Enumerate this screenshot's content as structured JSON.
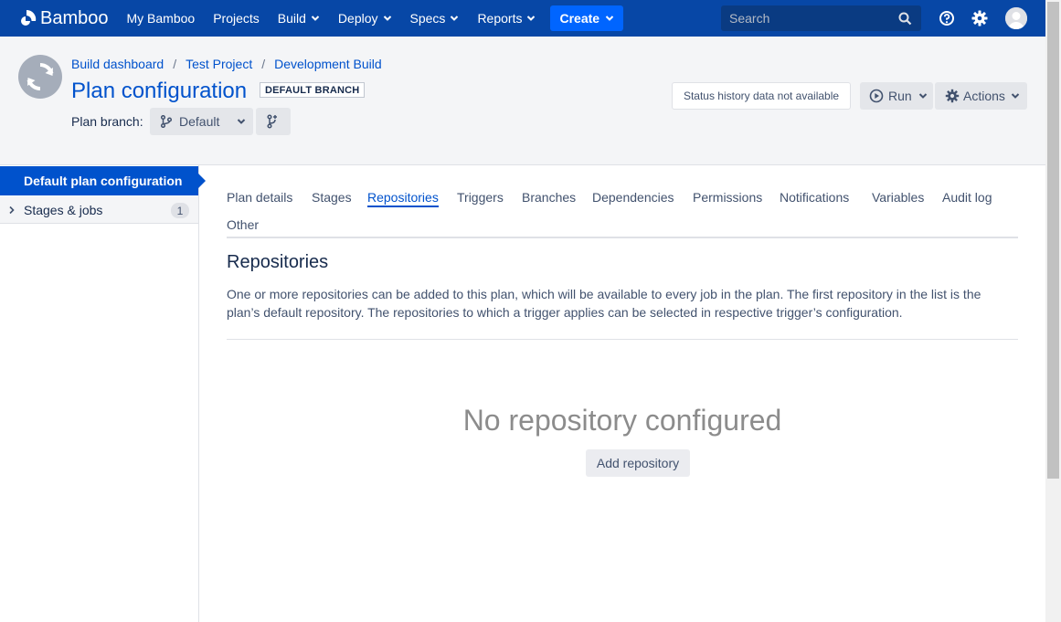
{
  "topnav": {
    "logo_text": "Bamboo",
    "items": [
      {
        "label": "My Bamboo",
        "has_dropdown": false
      },
      {
        "label": "Projects",
        "has_dropdown": false
      },
      {
        "label": "Build",
        "has_dropdown": true
      },
      {
        "label": "Deploy",
        "has_dropdown": true
      },
      {
        "label": "Specs",
        "has_dropdown": true
      },
      {
        "label": "Reports",
        "has_dropdown": true
      }
    ],
    "create_label": "Create",
    "search_placeholder": "Search",
    "bg_color": "#0747a6",
    "create_color": "#0065ff"
  },
  "header": {
    "breadcrumb": [
      "Build dashboard",
      "Test Project",
      "Development Build"
    ],
    "title": "Plan configuration",
    "badge": "DEFAULT BRANCH",
    "plan_branch_label": "Plan branch:",
    "branch_value": "Default",
    "status_text": "Status history data not available",
    "run_label": "Run",
    "actions_label": "Actions"
  },
  "sidebar": {
    "active_label": "Default plan configuration",
    "items": [
      {
        "label": "Stages & jobs",
        "count": "1"
      }
    ]
  },
  "tabs": [
    "Plan details",
    "Stages",
    "Repositories",
    "Triggers",
    "Branches",
    "Dependencies",
    "Permissions",
    "Notifications",
    "Variables",
    "Audit log",
    "Other"
  ],
  "active_tab": "Repositories",
  "content": {
    "title": "Repositories",
    "description": "One or more repositories can be added to this plan, which will be available to every job in the plan. The first repository in the list is the plan’s default repository. The repositories to which a trigger applies can be selected in respective trigger’s configuration.",
    "empty_message": "No repository configured",
    "add_button": "Add repository"
  },
  "icons": {
    "logo": "bamboo-logo-icon",
    "search": "search-icon",
    "help": "help-icon",
    "settings": "gear-icon",
    "avatar": "user-avatar-icon"
  }
}
